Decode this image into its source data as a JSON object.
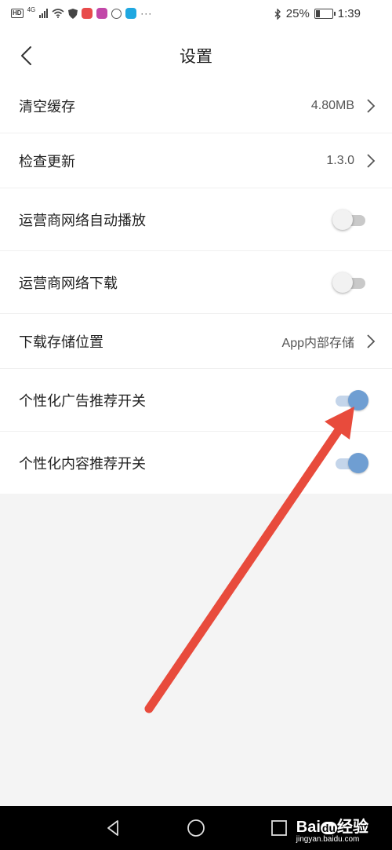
{
  "status_bar": {
    "network_badge": "HD",
    "network_type": "4G",
    "battery_percent": "25%",
    "time": "1:39",
    "more": "···"
  },
  "header": {
    "title": "设置"
  },
  "settings": [
    {
      "label": "清空缓存",
      "value": "4.80MB",
      "type": "link"
    },
    {
      "label": "检查更新",
      "value": "1.3.0",
      "type": "link"
    },
    {
      "label": "运营商网络自动播放",
      "type": "toggle",
      "on": false
    },
    {
      "label": "运营商网络下载",
      "type": "toggle",
      "on": false
    },
    {
      "label": "下载存储位置",
      "value": "App内部存储",
      "type": "link"
    },
    {
      "label": "个性化广告推荐开关",
      "type": "toggle",
      "on": true
    },
    {
      "label": "个性化内容推荐开关",
      "type": "toggle",
      "on": true
    }
  ],
  "watermark": {
    "main": "Bai",
    "mid": "du",
    "cn": "经验",
    "sub": "jingyan.baidu.com"
  },
  "colors": {
    "toggle_on": "#6f9ed2",
    "arrow": "#e84b3c"
  }
}
